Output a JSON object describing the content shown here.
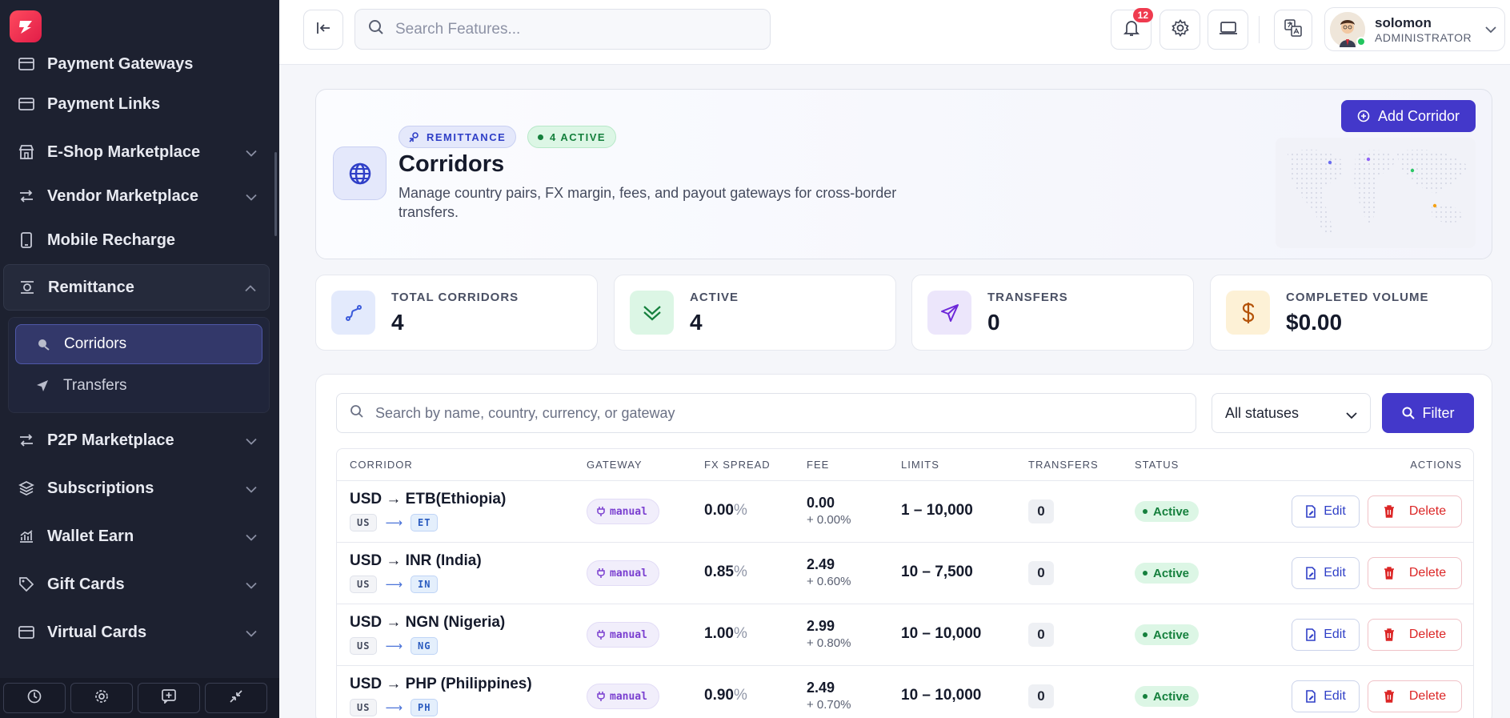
{
  "sidebar": {
    "items": [
      {
        "label": "Payment Gateways",
        "icon": "card-icon"
      },
      {
        "label": "Payment Links",
        "icon": "card-icon"
      },
      {
        "label": "E-Shop Marketplace",
        "icon": "store-icon"
      },
      {
        "label": "Vendor Marketplace",
        "icon": "swap-icon"
      },
      {
        "label": "Mobile Recharge",
        "icon": "phone-icon"
      },
      {
        "label": "Remittance",
        "icon": "remittance-icon"
      }
    ],
    "sub_items": [
      {
        "label": "Corridors",
        "icon": "globe-send-icon"
      },
      {
        "label": "Transfers",
        "icon": "send-icon"
      }
    ],
    "items_after": [
      {
        "label": "P2P Marketplace",
        "icon": "swap-icon"
      },
      {
        "label": "Subscriptions",
        "icon": "layers-icon"
      },
      {
        "label": "Wallet Earn",
        "icon": "chart-icon"
      },
      {
        "label": "Gift Cards",
        "icon": "tag-icon"
      },
      {
        "label": "Virtual Cards",
        "icon": "card-icon"
      }
    ]
  },
  "topbar": {
    "search_placeholder": "Search Features...",
    "notifications_count": "12",
    "user": {
      "name": "solomon",
      "role": "ADMINISTRATOR"
    }
  },
  "hero": {
    "tag": "REMITTANCE",
    "active_tag": "4 ACTIVE",
    "title": "Corridors",
    "description": "Manage country pairs, FX margin, fees, and payout gateways for cross-border transfers.",
    "add_button": "Add Corridor"
  },
  "stats": [
    {
      "label": "TOTAL CORRIDORS",
      "value": "4",
      "color": "#3b5bdb",
      "bg": "#e3eafc",
      "icon": "route-icon"
    },
    {
      "label": "ACTIVE",
      "value": "4",
      "color": "#15803d",
      "bg": "#dcf6e5",
      "icon": "chevrons-down-icon"
    },
    {
      "label": "TRANSFERS",
      "value": "0",
      "color": "#6d28d9",
      "bg": "#ece6fb",
      "icon": "send-icon"
    },
    {
      "label": "COMPLETED VOLUME",
      "value": "$0.00",
      "color": "#b45309",
      "bg": "#fdf1d6",
      "icon": "dollar-icon"
    }
  ],
  "table": {
    "search_placeholder": "Search by name, country, currency, or gateway",
    "status_filter": "All statuses",
    "filter_button": "Filter",
    "headers": [
      "CORRIDOR",
      "GATEWAY",
      "FX SPREAD",
      "FEE",
      "LIMITS",
      "TRANSFERS",
      "STATUS",
      "ACTIONS"
    ],
    "rows": [
      {
        "name": "USD → ETB(Ethiopia)",
        "from": "US",
        "to": "ET",
        "gateway": "manual",
        "fx": "0.00",
        "fee": "0.00",
        "fee_pct": "+ 0.00%",
        "limits": "1 – 10,000",
        "transfers": "0",
        "status": "Active"
      },
      {
        "name": "USD → INR (India)",
        "from": "US",
        "to": "IN",
        "gateway": "manual",
        "fx": "0.85",
        "fee": "2.49",
        "fee_pct": "+ 0.60%",
        "limits": "10 – 7,500",
        "transfers": "0",
        "status": "Active"
      },
      {
        "name": "USD → NGN (Nigeria)",
        "from": "US",
        "to": "NG",
        "gateway": "manual",
        "fx": "1.00",
        "fee": "2.99",
        "fee_pct": "+ 0.80%",
        "limits": "10 – 10,000",
        "transfers": "0",
        "status": "Active"
      },
      {
        "name": "USD → PHP (Philippines)",
        "from": "US",
        "to": "PH",
        "gateway": "manual",
        "fx": "0.90",
        "fee": "2.49",
        "fee_pct": "+ 0.70%",
        "limits": "10 – 10,000",
        "transfers": "0",
        "status": "Active"
      }
    ],
    "edit_label": "Edit",
    "delete_label": "Delete",
    "percent_sign": "%"
  }
}
